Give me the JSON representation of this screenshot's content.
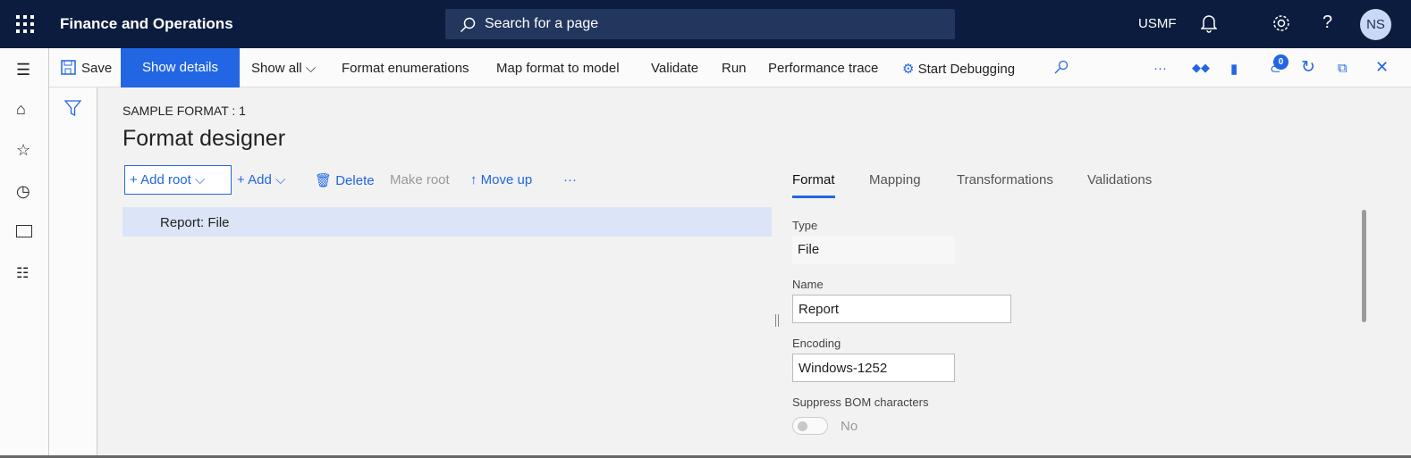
{
  "header": {
    "app_title": "Finance and Operations",
    "search_placeholder": "Search for a page",
    "company": "USMF",
    "avatar_initials": "NS"
  },
  "actions": {
    "save": "Save",
    "show_details": "Show details",
    "show_all": "Show all",
    "format_enumerations": "Format enumerations",
    "map_format_to_model": "Map format to model",
    "validate": "Validate",
    "run": "Run",
    "performance_trace": "Performance trace",
    "start_debugging": "Start Debugging",
    "notification_count": "0"
  },
  "page": {
    "breadcrumb": "SAMPLE FORMAT : 1",
    "title": "Format designer"
  },
  "tree_toolbar": {
    "add_root": "Add root",
    "add": "Add",
    "delete": "Delete",
    "make_root": "Make root",
    "move_up": "Move up"
  },
  "tree": {
    "items": [
      {
        "label": "Report: File",
        "selected": true
      }
    ]
  },
  "tabs": [
    {
      "label": "Format",
      "active": true
    },
    {
      "label": "Mapping"
    },
    {
      "label": "Transformations"
    },
    {
      "label": "Validations"
    }
  ],
  "details": {
    "type_label": "Type",
    "type_value": "File",
    "name_label": "Name",
    "name_value": "Report",
    "encoding_label": "Encoding",
    "encoding_value": "Windows-1252",
    "bom_label": "Suppress BOM characters",
    "bom_value": "No"
  },
  "colors": {
    "header": "#0c1c3f",
    "accent": "#2266e3"
  }
}
